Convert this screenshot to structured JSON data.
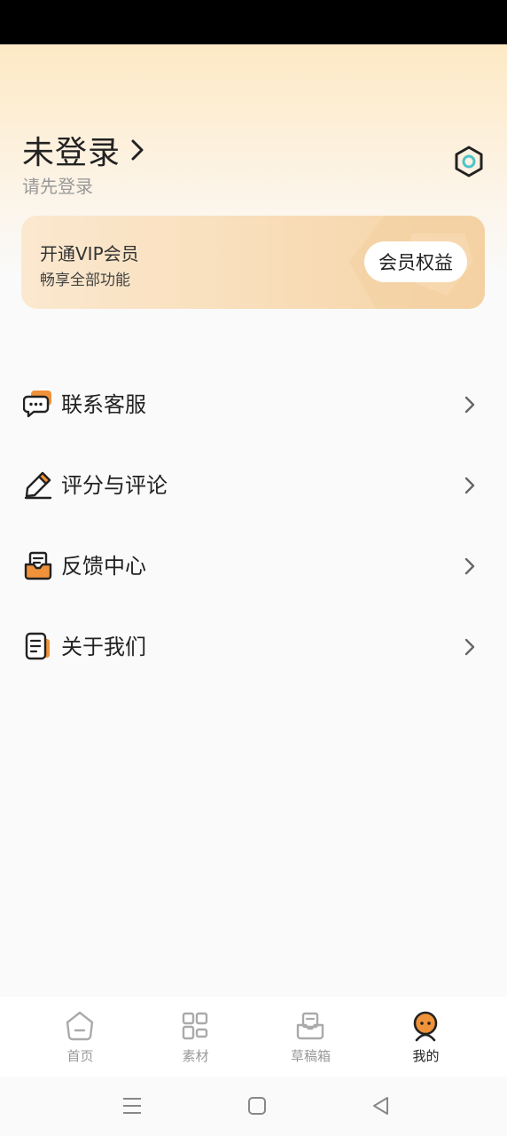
{
  "profile": {
    "login_title": "未登录",
    "login_subtitle": "请先登录"
  },
  "vip": {
    "title": "开通VIP会员",
    "subtitle": "畅享全部功能",
    "button_label": "会员权益"
  },
  "menu": {
    "items": [
      {
        "label": "联系客服",
        "icon": "chat-bubbles-icon"
      },
      {
        "label": "评分与评论",
        "icon": "pencil-icon"
      },
      {
        "label": "反馈中心",
        "icon": "inbox-icon"
      },
      {
        "label": "关于我们",
        "icon": "document-icon"
      }
    ]
  },
  "tabs": [
    {
      "label": "首页",
      "icon": "home-icon",
      "active": false
    },
    {
      "label": "素材",
      "icon": "grid-icon",
      "active": false
    },
    {
      "label": "草稿箱",
      "icon": "drafts-icon",
      "active": false
    },
    {
      "label": "我的",
      "icon": "profile-face-icon",
      "active": true
    }
  ],
  "colors": {
    "accent": "#f0923a",
    "vip_gradient_start": "#fbe8cf",
    "vip_gradient_end": "#f5d3a5",
    "text_primary": "#222222",
    "text_secondary": "#999999"
  }
}
